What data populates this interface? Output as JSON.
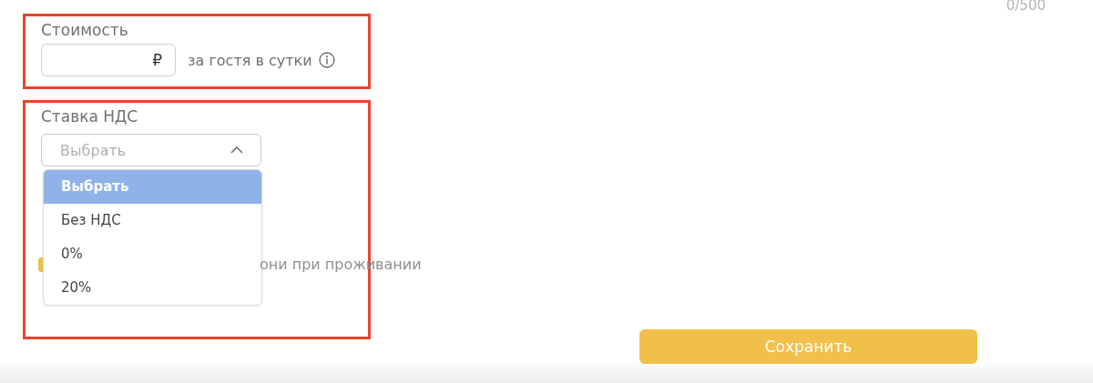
{
  "counter": "0/500",
  "price": {
    "label": "Стоимость",
    "currency": "₽",
    "suffix": "за гостя в сутки"
  },
  "vat": {
    "label": "Ставка НДС",
    "placeholder": "Выбрать",
    "expanded": true,
    "options": [
      {
        "label": "Выбрать",
        "selected": true
      },
      {
        "label": "Без НДС",
        "selected": false
      },
      {
        "label": "0%",
        "selected": false
      },
      {
        "label": "20%",
        "selected": false
      }
    ]
  },
  "option_row": {
    "checked": true,
    "label": "они при проживании"
  },
  "save_button": "Сохранить"
}
